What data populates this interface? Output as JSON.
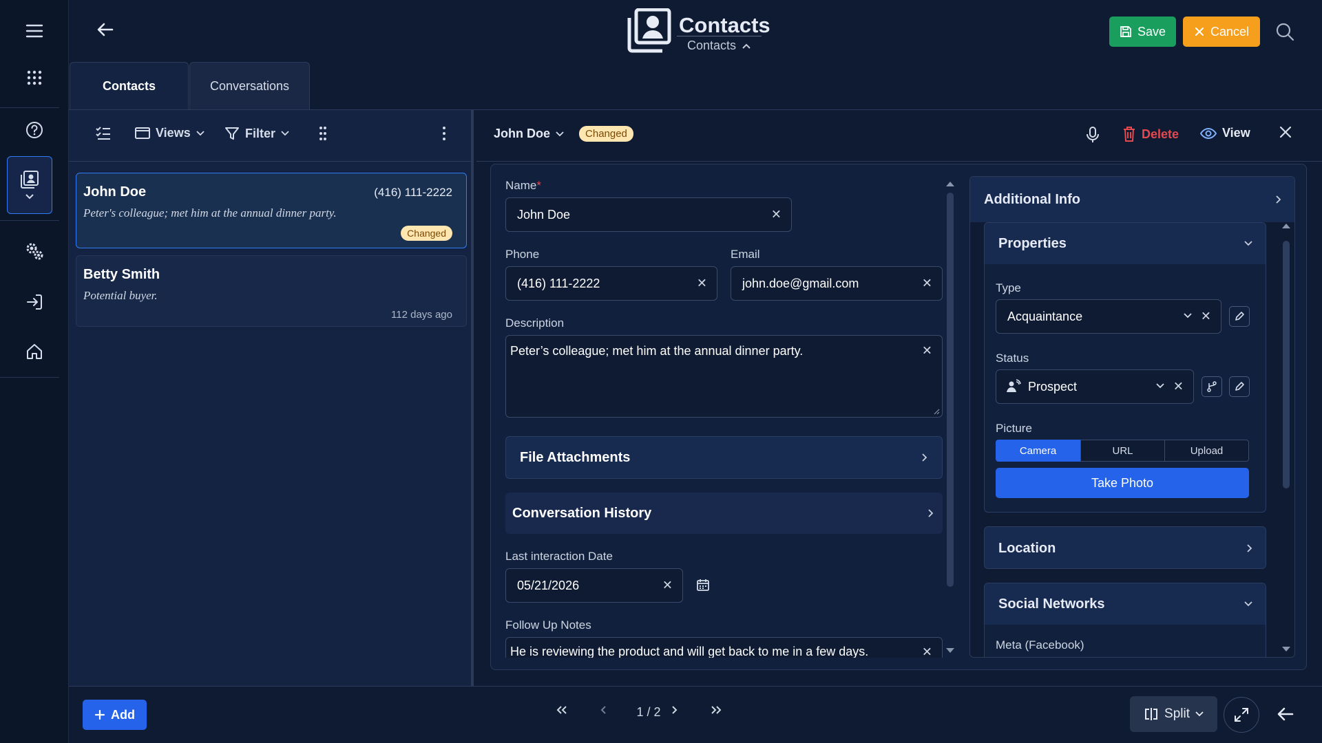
{
  "header": {
    "title": "Contacts",
    "subtitle": "Contacts",
    "save_label": "Save",
    "cancel_label": "Cancel"
  },
  "tabs": [
    {
      "label": "Contacts",
      "active": true
    },
    {
      "label": "Conversations",
      "active": false
    }
  ],
  "list_toolbar": {
    "views_label": "Views",
    "filter_label": "Filter"
  },
  "records": [
    {
      "name": "John Doe",
      "phone": "(416) 111-2222",
      "description": "Peter's colleague; met him at the annual dinner party.",
      "badge": "Changed",
      "time": ""
    },
    {
      "name": "Betty Smith",
      "phone": "",
      "description": "Potential buyer.",
      "badge": "",
      "time": "112 days ago"
    }
  ],
  "detail": {
    "record_name": "John Doe",
    "status_badge": "Changed",
    "delete_label": "Delete",
    "view_label": "View"
  },
  "form": {
    "name_label": "Name",
    "name_value": "John Doe",
    "phone_label": "Phone",
    "phone_value": "(416) 111-2222",
    "email_label": "Email",
    "email_value": "john.doe@gmail.com",
    "description_label": "Description",
    "description_value": "Peter’s colleague; met him at the annual dinner party.",
    "file_attachments_label": "File Attachments",
    "conversation_history_label": "Conversation History",
    "last_interaction_label": "Last interaction Date",
    "last_interaction_value": "05/21/2026",
    "follow_up_label": "Follow Up Notes",
    "follow_up_value": "He is reviewing the product and will get back to me in a few days."
  },
  "side": {
    "additional_info_label": "Additional Info",
    "properties_label": "Properties",
    "type_label": "Type",
    "type_value": "Acquaintance",
    "status_label": "Status",
    "status_value": "Prospect",
    "picture_label": "Picture",
    "picture_tabs": [
      "Camera",
      "URL",
      "Upload"
    ],
    "take_photo_label": "Take Photo",
    "location_label": "Location",
    "social_networks_label": "Social Networks",
    "meta_label": "Meta (Facebook)"
  },
  "footer": {
    "add_label": "Add",
    "page_indicator": "1 / 2",
    "split_label": "Split"
  },
  "colors": {
    "background": "#0f1b33",
    "accent": "#2563eb",
    "save": "#199e5e",
    "cancel": "#f59f1c",
    "danger": "#e5484d",
    "badge": "#fde6b0"
  }
}
